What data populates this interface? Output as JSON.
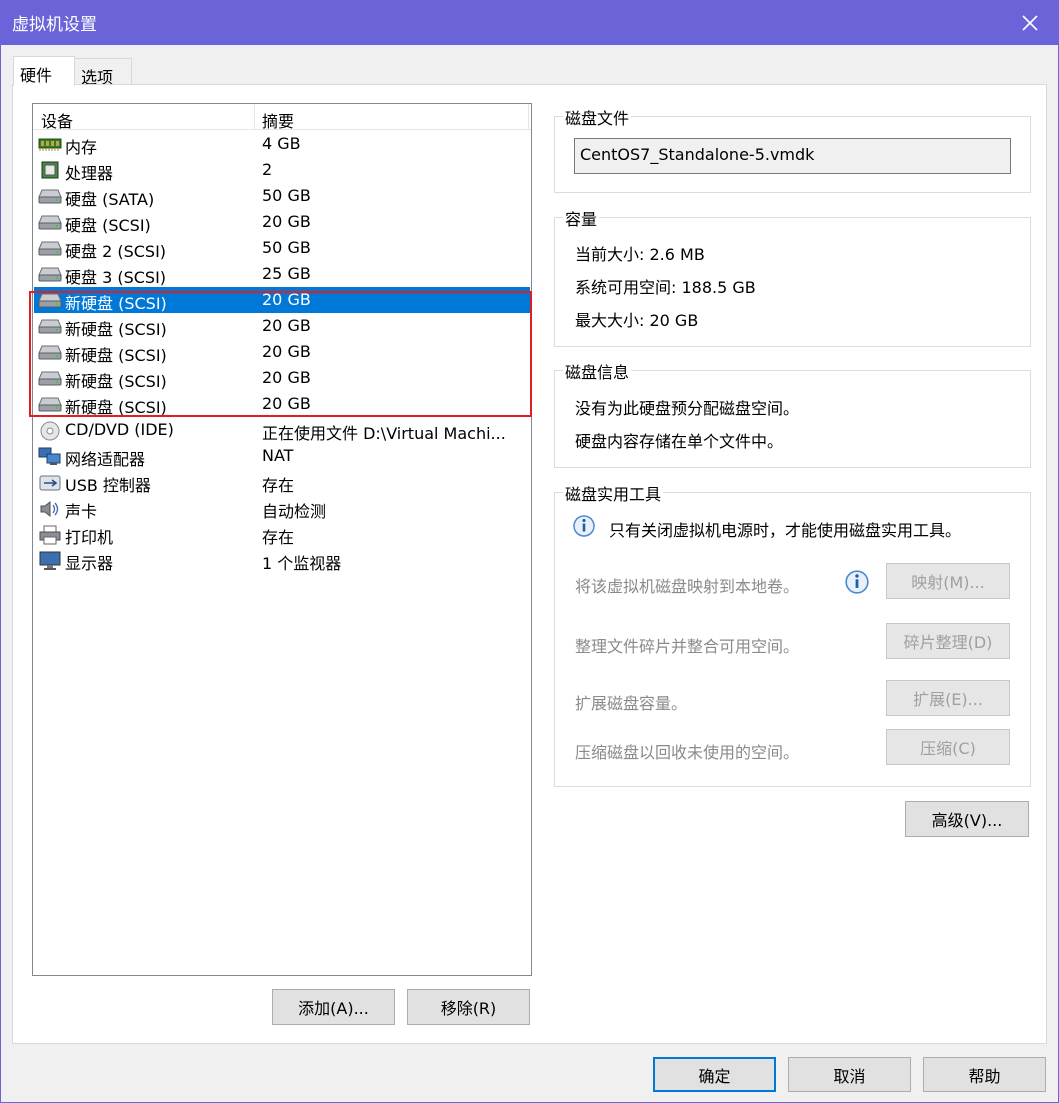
{
  "window": {
    "title": "虚拟机设置"
  },
  "tabs": [
    {
      "label": "硬件",
      "active": true
    },
    {
      "label": "选项",
      "active": false
    }
  ],
  "device_list": {
    "headers": {
      "device": "设备",
      "summary": "摘要"
    },
    "rows": [
      {
        "icon": "memory-icon",
        "device": "内存",
        "summary": "4 GB"
      },
      {
        "icon": "processor-icon",
        "device": "处理器",
        "summary": "2"
      },
      {
        "icon": "hard-disk-icon",
        "device": "硬盘 (SATA)",
        "summary": "50 GB"
      },
      {
        "icon": "hard-disk-icon",
        "device": "硬盘 (SCSI)",
        "summary": "20 GB"
      },
      {
        "icon": "hard-disk-icon",
        "device": "硬盘 2 (SCSI)",
        "summary": "50 GB"
      },
      {
        "icon": "hard-disk-icon",
        "device": "硬盘 3 (SCSI)",
        "summary": "25 GB"
      },
      {
        "icon": "hard-disk-icon",
        "device": "新硬盘 (SCSI)",
        "summary": "20 GB",
        "selected": true
      },
      {
        "icon": "hard-disk-icon",
        "device": "新硬盘 (SCSI)",
        "summary": "20 GB"
      },
      {
        "icon": "hard-disk-icon",
        "device": "新硬盘 (SCSI)",
        "summary": "20 GB"
      },
      {
        "icon": "hard-disk-icon",
        "device": "新硬盘 (SCSI)",
        "summary": "20 GB"
      },
      {
        "icon": "hard-disk-icon",
        "device": "新硬盘 (SCSI)",
        "summary": "20 GB"
      },
      {
        "icon": "cd-dvd-icon",
        "device": "CD/DVD (IDE)",
        "summary": "正在使用文件 D:\\Virtual Machi..."
      },
      {
        "icon": "network-adapter-icon",
        "device": "网络适配器",
        "summary": "NAT"
      },
      {
        "icon": "usb-icon",
        "device": "USB 控制器",
        "summary": "存在"
      },
      {
        "icon": "sound-icon",
        "device": "声卡",
        "summary": "自动检测"
      },
      {
        "icon": "printer-icon",
        "device": "打印机",
        "summary": "存在"
      },
      {
        "icon": "monitor-icon",
        "device": "显示器",
        "summary": "1 个监视器"
      }
    ],
    "highlight_color": "#e02020",
    "selection_color": "#0078d7"
  },
  "list_buttons": {
    "add": "添加(A)...",
    "remove": "移除(R)"
  },
  "disk_file": {
    "legend": "磁盘文件",
    "value": "CentOS7_Standalone-5.vmdk"
  },
  "capacity": {
    "legend": "容量",
    "current": "当前大小: 2.6 MB",
    "available": "系统可用空间: 188.5 GB",
    "max": "最大大小: 20 GB"
  },
  "disk_info": {
    "legend": "磁盘信息",
    "line1": "没有为此硬盘预分配磁盘空间。",
    "line2": "硬盘内容存储在单个文件中。"
  },
  "disk_utils": {
    "legend": "磁盘实用工具",
    "notice": "只有关闭虚拟机电源时，才能使用磁盘实用工具。",
    "map_text": "将该虚拟机磁盘映射到本地卷。",
    "map_button": "映射(M)...",
    "defrag_text": "整理文件碎片并整合可用空间。",
    "defrag_button": "碎片整理(D)",
    "expand_text": "扩展磁盘容量。",
    "expand_button": "扩展(E)...",
    "compact_text": "压缩磁盘以回收未使用的空间。",
    "compact_button": "压缩(C)"
  },
  "advanced_button": "高级(V)...",
  "footer": {
    "ok": "确定",
    "cancel": "取消",
    "help": "帮助"
  }
}
